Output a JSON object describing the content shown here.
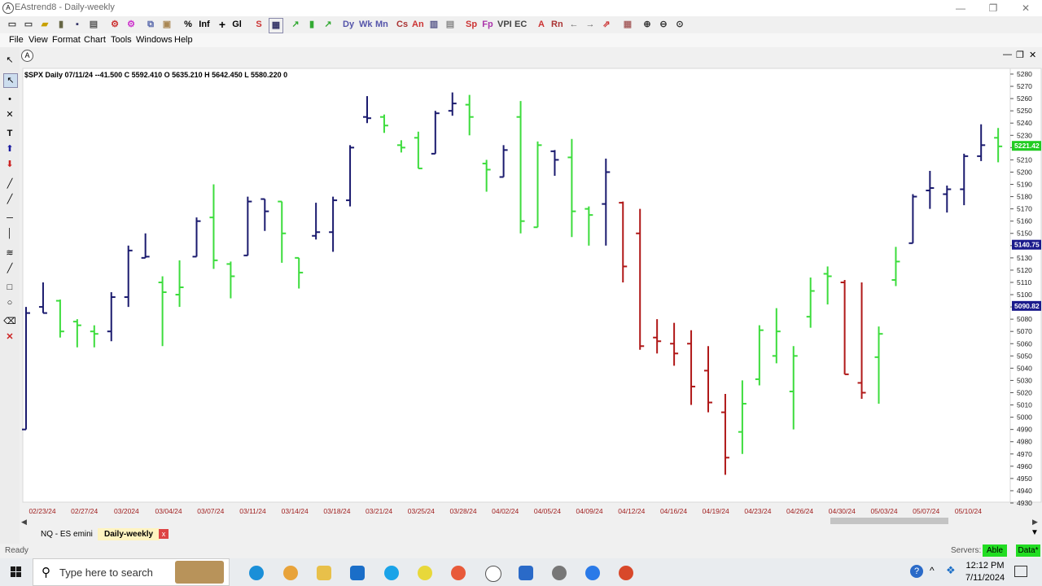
{
  "window": {
    "title": "EAstrend8 - Daily-weekly",
    "minimize": "—",
    "maximize": "❐",
    "close": "✕"
  },
  "toolbar": {
    "pct": "%",
    "inf": "Inf",
    "plus": "+",
    "gl": "Gl",
    "s": "S",
    "dy": "Dy",
    "wk": "Wk",
    "mn": "Mn",
    "cs": "Cs",
    "an": "An",
    "sp": "Sp",
    "fp": "Fp",
    "vpi": "VPI",
    "ec": "EC",
    "a": "A",
    "rn": "Rn"
  },
  "menu": [
    "File",
    "View",
    "Format",
    "Chart",
    "Tools",
    "Windows",
    "Help"
  ],
  "chart_header": "$SPX  Daily 07/11/24 --41.500 C 5592.410 O 5635.210 H 5642.450 L 5580.220 0",
  "chart_data": {
    "type": "ohlc",
    "ylim": [
      4930,
      5280
    ],
    "y_ticks": [
      5280,
      5270,
      5260,
      5250,
      5240,
      5230,
      5220,
      5210,
      5200,
      5190,
      5180,
      5170,
      5160,
      5150,
      5140,
      5130,
      5120,
      5110,
      5100,
      5090,
      5080,
      5070,
      5060,
      5050,
      5040,
      5030,
      5020,
      5010,
      5000,
      4990,
      4980,
      4970,
      4960,
      4950,
      4940,
      4930
    ],
    "x_labels": [
      "02/23/24",
      "02/27/24",
      "03/2024",
      "03/04/24",
      "03/07/24",
      "03/11/24",
      "03/14/24",
      "03/18/24",
      "03/21/24",
      "03/25/24",
      "03/28/24",
      "04/02/24",
      "04/05/24",
      "04/09/24",
      "04/12/24",
      "04/16/24",
      "04/19/24",
      "04/23/24",
      "04/26/24",
      "04/30/24",
      "05/03/24",
      "05/07/24",
      "05/10/24"
    ],
    "price_tags": [
      {
        "label": "5221.42",
        "value": 5221.42,
        "color": "#22cc22"
      },
      {
        "label": "5140.75",
        "value": 5140.75,
        "color": "#1a1a8c"
      },
      {
        "label": "5090.82",
        "value": 5090.82,
        "color": "#1a1a8c"
      }
    ],
    "colors": {
      "navy": "#1a1a6e",
      "green": "#3cdc3c",
      "red": "#b01818",
      "blue_marker": "#1a1aa0"
    },
    "bars": [
      {
        "o": 4990,
        "h": 5090,
        "l": 4990,
        "c": 5085,
        "col": "navy"
      },
      {
        "o": 5090,
        "h": 5110,
        "l": 5085,
        "c": 5085,
        "col": "navy"
      },
      {
        "o": 5095,
        "h": 5096,
        "l": 5065,
        "c": 5070,
        "col": "green"
      },
      {
        "o": 5078,
        "h": 5080,
        "l": 5057,
        "c": 5075,
        "col": "green"
      },
      {
        "o": 5070,
        "h": 5075,
        "l": 5057,
        "c": 5068,
        "col": "green"
      },
      {
        "o": 5070,
        "h": 5102,
        "l": 5062,
        "c": 5098,
        "col": "navy"
      },
      {
        "o": 5098,
        "h": 5140,
        "l": 5090,
        "c": 5136,
        "col": "navy"
      },
      {
        "o": 5130,
        "h": 5150,
        "l": 5130,
        "c": 5131,
        "col": "navy"
      },
      {
        "o": 5110,
        "h": 5115,
        "l": 5058,
        "c": 5102,
        "col": "green"
      },
      {
        "o": 5100,
        "h": 5128,
        "l": 5090,
        "c": 5106,
        "col": "green"
      },
      {
        "o": 5131,
        "h": 5163,
        "l": 5131,
        "c": 5160,
        "col": "navy"
      },
      {
        "o": 5163,
        "h": 5190,
        "l": 5121,
        "c": 5128,
        "col": "green"
      },
      {
        "o": 5125,
        "h": 5127,
        "l": 5097,
        "c": 5115,
        "col": "green"
      },
      {
        "o": 5132,
        "h": 5180,
        "l": 5132,
        "c": 5176,
        "col": "navy"
      },
      {
        "o": 5178,
        "h": 5178,
        "l": 5152,
        "c": 5168,
        "col": "navy"
      },
      {
        "o": 5176,
        "h": 5176,
        "l": 5126,
        "c": 5150,
        "col": "green"
      },
      {
        "o": 5130,
        "h": 5130,
        "l": 5105,
        "c": 5118,
        "col": "green"
      },
      {
        "o": 5148,
        "h": 5175,
        "l": 5145,
        "c": 5151,
        "col": "navy"
      },
      {
        "o": 5151,
        "h": 5180,
        "l": 5135,
        "c": 5177,
        "col": "navy"
      },
      {
        "o": 5177,
        "h": 5222,
        "l": 5172,
        "c": 5220,
        "col": "navy"
      },
      {
        "o": 5245,
        "h": 5262,
        "l": 5240,
        "c": 5244,
        "col": "navy"
      },
      {
        "o": 5245,
        "h": 5247,
        "l": 5232,
        "c": 5238,
        "col": "green"
      },
      {
        "o": 5222,
        "h": 5226,
        "l": 5216,
        "c": 5220,
        "col": "green"
      },
      {
        "o": 5228,
        "h": 5233,
        "l": 5203,
        "c": 5203,
        "col": "green"
      },
      {
        "o": 5215,
        "h": 5250,
        "l": 5215,
        "c": 5248,
        "col": "navy"
      },
      {
        "o": 5250,
        "h": 5265,
        "l": 5246,
        "c": 5256,
        "col": "navy"
      },
      {
        "o": 5255,
        "h": 5263,
        "l": 5230,
        "c": 5245,
        "col": "green"
      },
      {
        "o": 5207,
        "h": 5210,
        "l": 5184,
        "c": 5202,
        "col": "green"
      },
      {
        "o": 5196,
        "h": 5222,
        "l": 5196,
        "c": 5218,
        "col": "navy"
      },
      {
        "o": 5245,
        "h": 5258,
        "l": 5150,
        "c": 5160,
        "col": "green"
      },
      {
        "o": 5155,
        "h": 5225,
        "l": 5155,
        "c": 5222,
        "col": "green"
      },
      {
        "o": 5217,
        "h": 5218,
        "l": 5197,
        "c": 5210,
        "col": "navy"
      },
      {
        "o": 5212,
        "h": 5227,
        "l": 5147,
        "c": 5168,
        "col": "green"
      },
      {
        "o": 5170,
        "h": 5172,
        "l": 5140,
        "c": 5165,
        "col": "green"
      },
      {
        "o": 5174,
        "h": 5211,
        "l": 5140,
        "c": 5200,
        "col": "navy"
      },
      {
        "o": 5175,
        "h": 5176,
        "l": 5110,
        "c": 5123,
        "col": "red"
      },
      {
        "o": 5150,
        "h": 5170,
        "l": 5055,
        "c": 5058,
        "col": "red"
      },
      {
        "o": 5065,
        "h": 5080,
        "l": 5052,
        "c": 5062,
        "col": "red"
      },
      {
        "o": 5060,
        "h": 5077,
        "l": 5042,
        "c": 5052,
        "col": "red"
      },
      {
        "o": 5060,
        "h": 5071,
        "l": 5010,
        "c": 5025,
        "col": "red"
      },
      {
        "o": 5038,
        "h": 5058,
        "l": 5004,
        "c": 5012,
        "col": "red"
      },
      {
        "o": 5004,
        "h": 5019,
        "l": 4953,
        "c": 4967,
        "col": "red"
      },
      {
        "o": 4988,
        "h": 5030,
        "l": 4970,
        "c": 5011,
        "col": "green"
      },
      {
        "o": 5031,
        "h": 5075,
        "l": 5026,
        "c": 5071,
        "col": "green"
      },
      {
        "o": 5050,
        "h": 5089,
        "l": 5044,
        "c": 5070,
        "col": "green"
      },
      {
        "o": 5021,
        "h": 5058,
        "l": 4990,
        "c": 5050,
        "col": "green"
      },
      {
        "o": 5082,
        "h": 5114,
        "l": 5073,
        "c": 5103,
        "col": "green"
      },
      {
        "o": 5117,
        "h": 5123,
        "l": 5092,
        "c": 5115,
        "col": "green"
      },
      {
        "o": 5110,
        "h": 5112,
        "l": 5035,
        "c": 5035,
        "col": "red"
      },
      {
        "o": 5028,
        "h": 5110,
        "l": 5015,
        "c": 5020,
        "col": "red"
      },
      {
        "o": 5049,
        "h": 5074,
        "l": 5011,
        "c": 5068,
        "col": "green"
      },
      {
        "o": 5112,
        "h": 5139,
        "l": 5107,
        "c": 5127,
        "col": "green"
      },
      {
        "o": 5142,
        "h": 5182,
        "l": 5142,
        "c": 5180,
        "col": "navy"
      },
      {
        "o": 5185,
        "h": 5201,
        "l": 5170,
        "c": 5187,
        "col": "navy"
      },
      {
        "o": 5182,
        "h": 5189,
        "l": 5167,
        "c": 5186,
        "col": "navy"
      },
      {
        "o": 5186,
        "h": 5215,
        "l": 5173,
        "c": 5213,
        "col": "navy"
      },
      {
        "o": 5213,
        "h": 5239,
        "l": 5209,
        "c": 5222,
        "col": "navy"
      },
      {
        "o": 5228,
        "h": 5236,
        "l": 5208,
        "c": 5221,
        "col": "green"
      }
    ]
  },
  "tabs": [
    {
      "label": "NQ - ES emini"
    },
    {
      "label": "Daily-weekly",
      "close": "x"
    }
  ],
  "status": {
    "ready": "Ready",
    "servers": "Servers:",
    "able": "Able",
    "data": "Data*"
  },
  "taskbar": {
    "search_placeholder": "Type here to search",
    "time": "12:12 PM",
    "date": "7/11/2024"
  }
}
